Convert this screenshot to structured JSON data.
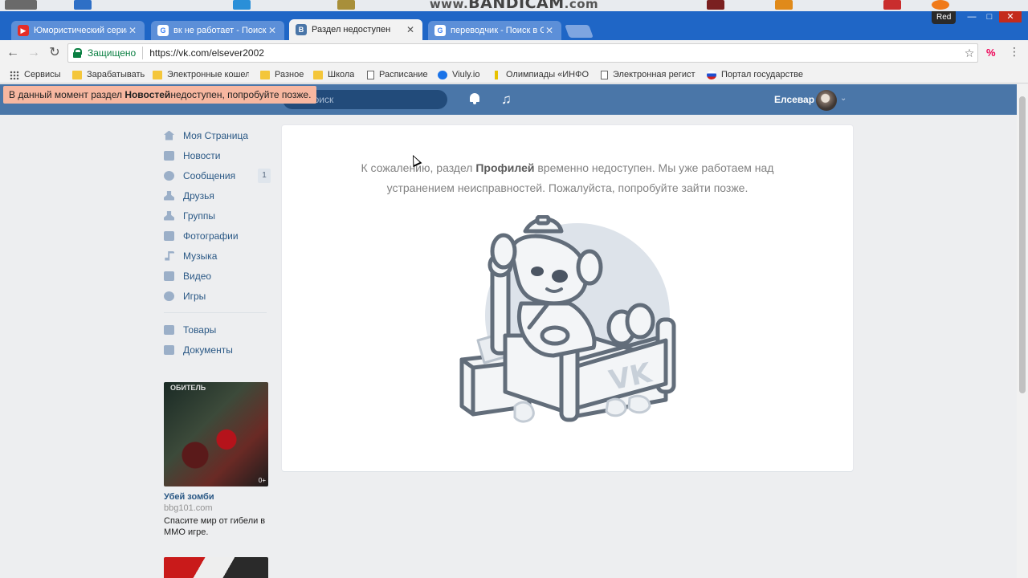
{
  "watermark": {
    "prefix": "www.",
    "brand": "BANDICAM",
    "suffix": ".com"
  },
  "browser": {
    "profile": "Red",
    "tabs": [
      {
        "label": "Юмористический сериал",
        "icon": "youtube-icon",
        "color": "#e52d27",
        "active": false
      },
      {
        "label": "вк не работает - Поиск",
        "icon": "google-icon",
        "color": "#4285f4",
        "active": false
      },
      {
        "label": "Раздел недоступен",
        "icon": "vk-icon",
        "color": "#4a76a8",
        "active": true
      },
      {
        "label": "переводчик - Поиск в G",
        "icon": "google-icon",
        "color": "#4285f4",
        "active": false
      }
    ],
    "address": {
      "secure_label": "Защищено",
      "url": "https://vk.com/elsever2002"
    },
    "bookmarks": [
      {
        "label": "Сервисы",
        "icon": "apps"
      },
      {
        "label": "Зарабатывать",
        "icon": "folder"
      },
      {
        "label": "Электронные кошел",
        "icon": "folder"
      },
      {
        "label": "Разное",
        "icon": "folder"
      },
      {
        "label": "Школа",
        "icon": "folder"
      },
      {
        "label": "Расписание",
        "icon": "page"
      },
      {
        "label": "Viuly.io",
        "icon": "viuly"
      },
      {
        "label": "Олимпиады «ИНФО",
        "icon": "pin"
      },
      {
        "label": "Электронная регист",
        "icon": "page"
      },
      {
        "label": "Портал государстве",
        "icon": "flag"
      }
    ]
  },
  "vk": {
    "search_placeholder": "Поиск",
    "user_name": "Елсевар",
    "toast": {
      "before": "В данный момент раздел ",
      "bold": "Новостей",
      "after": " недоступен, попробуйте позже."
    },
    "nav": [
      {
        "label": "Моя Страница",
        "icon": "home-icon"
      },
      {
        "label": "Новости",
        "icon": "news-icon"
      },
      {
        "label": "Сообщения",
        "icon": "messages-icon",
        "badge": "1"
      },
      {
        "label": "Друзья",
        "icon": "friends-icon"
      },
      {
        "label": "Группы",
        "icon": "groups-icon"
      },
      {
        "label": "Фотографии",
        "icon": "camera-icon"
      },
      {
        "label": "Музыка",
        "icon": "music-note-icon"
      },
      {
        "label": "Видео",
        "icon": "video-icon"
      },
      {
        "label": "Игры",
        "icon": "gamepad-icon"
      }
    ],
    "nav_secondary": [
      {
        "label": "Товары",
        "icon": "shopping-bag-icon"
      },
      {
        "label": "Документы",
        "icon": "document-icon"
      }
    ],
    "ad": {
      "image_text": "ОБИТЕЛЬ",
      "age": "0+",
      "title": "Убей зомби",
      "domain": "bbg101.com",
      "description": "Спасите мир от гибели в ММО игре."
    },
    "error": {
      "before": "К сожалению, раздел ",
      "bold": "Профилей",
      "after": " временно недоступен. Мы уже работаем над устранением неисправностей. Пожалуйста, попробуйте зайти позже."
    },
    "colors": {
      "header": "#4a76a8",
      "link": "#2a5885",
      "toast": "#f7b7a0",
      "page_bg": "#edeef0"
    }
  }
}
